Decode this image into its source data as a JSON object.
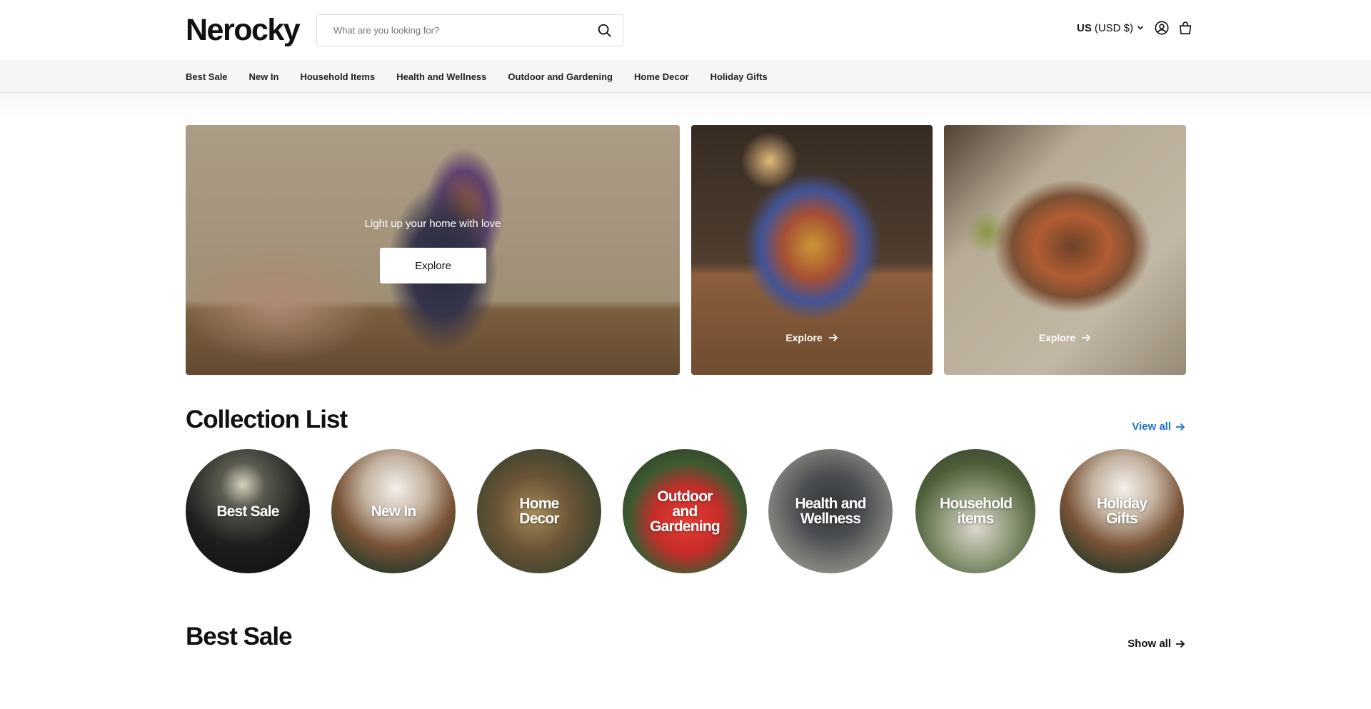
{
  "header": {
    "logo": "Nerocky",
    "search_placeholder": "What are you looking for?",
    "currency_country": "US",
    "currency_code": "(USD $)"
  },
  "nav": {
    "items": [
      {
        "label": "Best Sale"
      },
      {
        "label": "New In"
      },
      {
        "label": "Household Items"
      },
      {
        "label": "Health and Wellness"
      },
      {
        "label": "Outdoor and Gardening"
      },
      {
        "label": "Home Decor"
      },
      {
        "label": "Holiday Gifts"
      }
    ]
  },
  "hero": {
    "main_caption": "Light up your home with love",
    "main_button": "Explore",
    "tile2_link": "Explore",
    "tile3_link": "Explore"
  },
  "collections": {
    "title": "Collection List",
    "view_all": "View all",
    "items": [
      {
        "label": "Best Sale"
      },
      {
        "label": "New In"
      },
      {
        "label": "Home Decor"
      },
      {
        "label": "Outdoor and Gardening"
      },
      {
        "label": "Health and Wellness"
      },
      {
        "label": "Household items"
      },
      {
        "label": "Holiday Gifts"
      }
    ]
  },
  "best_sale": {
    "title": "Best Sale",
    "show_all": "Show all"
  },
  "colors": {
    "accent_link": "#1a73c9",
    "nav_bg": "#f6f6f6",
    "text": "#111111"
  }
}
